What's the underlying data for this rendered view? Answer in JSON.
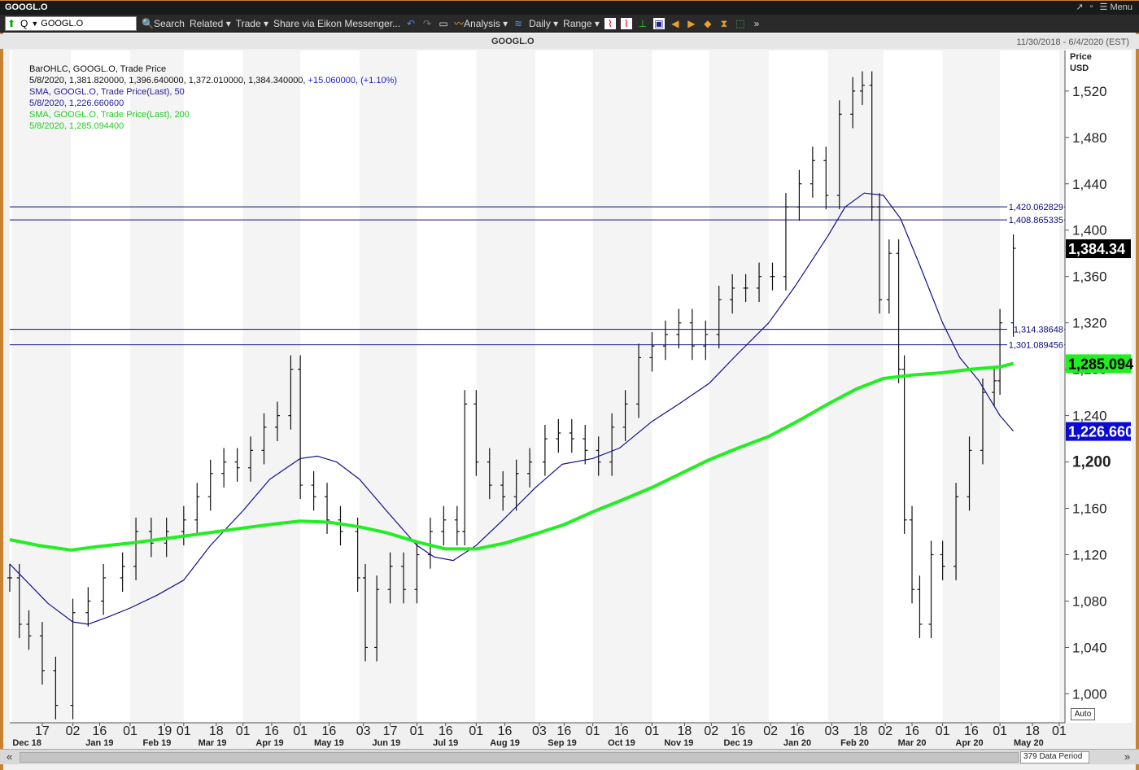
{
  "window": {
    "title": "GOOGL.O",
    "menu_label": "Menu"
  },
  "toolbar": {
    "ric_mode": "Q",
    "ric_value": "GOOGL.O",
    "search_label": "Search",
    "related_label": "Related",
    "trade_label": "Trade",
    "share_label": "Share via Eikon Messenger...",
    "analysis_label": "Analysis",
    "interval_label": "Daily",
    "range_label": "Range"
  },
  "chart_header": {
    "symbol": "GOOGL.O",
    "date_range": "11/30/2018 - 6/4/2020 (EST)"
  },
  "legend": {
    "line1": "BarOHLC, GOOGL.O, Trade Price",
    "line2": "5/8/2020, 1,381.820000, 1,396.640000, 1,372.010000, 1,384.340000,",
    "line2_change": "+15.060000, (+1.10%)",
    "line3": "SMA, GOOGL.O, Trade Price(Last),  50",
    "line4": "5/8/2020, 1,226.660600",
    "line5": "SMA, GOOGL.O, Trade Price(Last),  200",
    "line6": "5/8/2020, 1,285.094400"
  },
  "status": {
    "data_period": "379 Data Period",
    "auto_label": "Auto"
  },
  "colors": {
    "frame": "#c9822e",
    "sma50": "#10108a",
    "sma200": "#22ee22",
    "bars": "#111111",
    "hline": "#0a0a7a"
  },
  "chart_data": {
    "type": "line",
    "title": "GOOGL.O",
    "ylabel": "Price USD",
    "ylabel_line1": "Price",
    "ylabel_line2": "USD",
    "ylim": [
      975,
      1555
    ],
    "y_ticks": [
      1000,
      1040,
      1080,
      1120,
      1160,
      1200,
      1240,
      1280,
      1320,
      1360,
      1400,
      1440,
      1480,
      1520
    ],
    "y_tick_labels": [
      "1,000",
      "1,040",
      "1,080",
      "1,120",
      "1,160",
      "1,200",
      "1,240",
      "1,280",
      "1,320",
      "1,360",
      "1,400",
      "1,440",
      "1,480",
      "1,520"
    ],
    "x_tick_labels": [
      "17",
      "02",
      "16",
      "01",
      "19",
      "01",
      "18",
      "01",
      "16",
      "01",
      "16",
      "03",
      "17",
      "01",
      "16",
      "01",
      "16",
      "03",
      "16",
      "01",
      "16",
      "01",
      "18",
      "02",
      "16",
      "02",
      "16",
      "03",
      "18",
      "02",
      "16",
      "01",
      "16",
      "01",
      "18",
      "01"
    ],
    "x_tick_dates": [
      "2018-12-17",
      "2019-01-02",
      "2019-01-16",
      "2019-02-01",
      "2019-02-19",
      "2019-03-01",
      "2019-03-18",
      "2019-04-01",
      "2019-04-16",
      "2019-05-01",
      "2019-05-16",
      "2019-06-03",
      "2019-06-17",
      "2019-07-01",
      "2019-07-16",
      "2019-08-01",
      "2019-08-16",
      "2019-09-03",
      "2019-09-16",
      "2019-10-01",
      "2019-10-16",
      "2019-11-01",
      "2019-11-18",
      "2019-12-02",
      "2019-12-16",
      "2020-01-02",
      "2020-01-16",
      "2020-02-03",
      "2020-02-18",
      "2020-03-02",
      "2020-03-16",
      "2020-04-01",
      "2020-04-16",
      "2020-05-01",
      "2020-05-18",
      "2020-06-01"
    ],
    "month_labels": [
      "Dec 18",
      "Jan 19",
      "Feb 19",
      "Mar 19",
      "Apr 19",
      "May 19",
      "Jun 19",
      "Jul 19",
      "Aug 19",
      "Sep 19",
      "Oct 19",
      "Nov 19",
      "Dec 19",
      "Jan 20",
      "Feb 20",
      "Mar 20",
      "Apr 20",
      "May 20"
    ],
    "month_label_dates": [
      "2018-12-09",
      "2019-01-16",
      "2019-02-15",
      "2019-03-16",
      "2019-04-15",
      "2019-05-16",
      "2019-06-15",
      "2019-07-16",
      "2019-08-16",
      "2019-09-15",
      "2019-10-16",
      "2019-11-15",
      "2019-12-16",
      "2020-01-16",
      "2020-02-15",
      "2020-03-16",
      "2020-04-15",
      "2020-05-16"
    ],
    "x_start": "2018-11-30",
    "x_end": "2020-06-04",
    "horizontal_lines": [
      {
        "value": 1420.062829,
        "label": "1,420.062829"
      },
      {
        "value": 1408.865335,
        "label": "1,408.865335"
      },
      {
        "value": 1314.38648,
        "label": "1,314.38648"
      },
      {
        "value": 1301.089456,
        "label": "1,301.089456"
      }
    ],
    "last_price": {
      "value": 1384.34,
      "label": "1,384.34"
    },
    "sma200_last": {
      "value": 1285.0944,
      "label": "1,285.094"
    },
    "sma50_last": {
      "value": 1226.6606,
      "label": "1,226.660"
    },
    "bold_tick": {
      "value": 1200,
      "label": "1,200"
    },
    "series": [
      {
        "name": "SMA, GOOGL.O, Trade Price(Last),  50",
        "x": [
          "2018-11-30",
          "2018-12-10",
          "2018-12-20",
          "2019-01-02",
          "2019-01-10",
          "2019-01-20",
          "2019-02-01",
          "2019-02-15",
          "2019-03-01",
          "2019-03-15",
          "2019-04-01",
          "2019-04-15",
          "2019-05-01",
          "2019-05-10",
          "2019-05-20",
          "2019-06-01",
          "2019-06-15",
          "2019-07-01",
          "2019-07-10",
          "2019-07-20",
          "2019-08-01",
          "2019-08-15",
          "2019-09-01",
          "2019-09-15",
          "2019-10-01",
          "2019-10-15",
          "2019-11-01",
          "2019-11-15",
          "2019-12-01",
          "2019-12-15",
          "2020-01-01",
          "2020-01-15",
          "2020-02-01",
          "2020-02-10",
          "2020-02-20",
          "2020-03-01",
          "2020-03-10",
          "2020-03-20",
          "2020-04-01",
          "2020-04-10",
          "2020-04-20",
          "2020-05-01",
          "2020-05-08"
        ],
        "values": [
          1112,
          1095,
          1078,
          1062,
          1060,
          1066,
          1074,
          1085,
          1098,
          1128,
          1158,
          1185,
          1203,
          1205,
          1200,
          1185,
          1158,
          1128,
          1118,
          1115,
          1128,
          1150,
          1178,
          1198,
          1203,
          1212,
          1235,
          1250,
          1268,
          1292,
          1320,
          1352,
          1395,
          1420,
          1432,
          1430,
          1410,
          1370,
          1320,
          1290,
          1270,
          1240,
          1226.66
        ]
      },
      {
        "name": "SMA, GOOGL.O, Trade Price(Last),  200",
        "x": [
          "2018-11-30",
          "2018-12-15",
          "2019-01-01",
          "2019-01-15",
          "2019-02-01",
          "2019-03-01",
          "2019-04-01",
          "2019-04-20",
          "2019-05-01",
          "2019-05-16",
          "2019-06-01",
          "2019-06-15",
          "2019-07-01",
          "2019-07-16",
          "2019-08-01",
          "2019-08-16",
          "2019-09-01",
          "2019-09-16",
          "2019-10-01",
          "2019-10-16",
          "2019-11-01",
          "2019-11-16",
          "2019-12-01",
          "2019-12-16",
          "2020-01-01",
          "2020-01-16",
          "2020-02-01",
          "2020-02-16",
          "2020-03-01",
          "2020-03-16",
          "2020-04-01",
          "2020-04-16",
          "2020-05-01",
          "2020-05-08"
        ],
        "values": [
          1133,
          1128,
          1124,
          1127,
          1130,
          1136,
          1143,
          1147,
          1149,
          1148,
          1144,
          1139,
          1131,
          1125,
          1125,
          1130,
          1138,
          1146,
          1157,
          1167,
          1178,
          1190,
          1202,
          1212,
          1222,
          1235,
          1250,
          1263,
          1272,
          1275,
          1277,
          1280,
          1282,
          1285.09
        ]
      }
    ],
    "ohlc_close": {
      "x": [
        "2018-11-30",
        "2018-12-05",
        "2018-12-10",
        "2018-12-17",
        "2018-12-24",
        "2019-01-02",
        "2019-01-10",
        "2019-01-18",
        "2019-01-28",
        "2019-02-04",
        "2019-02-12",
        "2019-02-20",
        "2019-03-01",
        "2019-03-08",
        "2019-03-15",
        "2019-03-22",
        "2019-03-29",
        "2019-04-05",
        "2019-04-12",
        "2019-04-19",
        "2019-04-26",
        "2019-05-01",
        "2019-05-08",
        "2019-05-15",
        "2019-05-22",
        "2019-05-31",
        "2019-06-04",
        "2019-06-10",
        "2019-06-17",
        "2019-06-24",
        "2019-07-01",
        "2019-07-08",
        "2019-07-15",
        "2019-07-22",
        "2019-07-26",
        "2019-08-01",
        "2019-08-08",
        "2019-08-15",
        "2019-08-22",
        "2019-08-29",
        "2019-09-06",
        "2019-09-13",
        "2019-09-20",
        "2019-09-27",
        "2019-10-04",
        "2019-10-11",
        "2019-10-18",
        "2019-10-25",
        "2019-11-01",
        "2019-11-08",
        "2019-11-15",
        "2019-11-22",
        "2019-11-29",
        "2019-12-06",
        "2019-12-13",
        "2019-12-20",
        "2019-12-27",
        "2020-01-03",
        "2020-01-10",
        "2020-01-17",
        "2020-01-24",
        "2020-01-31",
        "2020-02-07",
        "2020-02-14",
        "2020-02-19",
        "2020-02-24",
        "2020-02-28",
        "2020-03-04",
        "2020-03-09",
        "2020-03-12",
        "2020-03-16",
        "2020-03-20",
        "2020-03-26",
        "2020-04-01",
        "2020-04-08",
        "2020-04-15",
        "2020-04-22",
        "2020-04-28",
        "2020-05-01",
        "2020-05-08"
      ],
      "values": [
        1100,
        1060,
        1050,
        1020,
        990,
        1070,
        1080,
        1100,
        1110,
        1140,
        1130,
        1140,
        1150,
        1170,
        1190,
        1200,
        1195,
        1210,
        1230,
        1240,
        1280,
        1180,
        1170,
        1150,
        1140,
        1100,
        1040,
        1090,
        1110,
        1090,
        1120,
        1140,
        1150,
        1140,
        1250,
        1200,
        1180,
        1170,
        1190,
        1200,
        1220,
        1225,
        1220,
        1210,
        1200,
        1230,
        1250,
        1290,
        1300,
        1310,
        1320,
        1300,
        1310,
        1340,
        1350,
        1350,
        1360,
        1360,
        1420,
        1440,
        1460,
        1430,
        1500,
        1520,
        1525,
        1420,
        1340,
        1380,
        1280,
        1150,
        1090,
        1060,
        1120,
        1110,
        1170,
        1210,
        1260,
        1270,
        1320,
        1384.34
      ]
    }
  }
}
